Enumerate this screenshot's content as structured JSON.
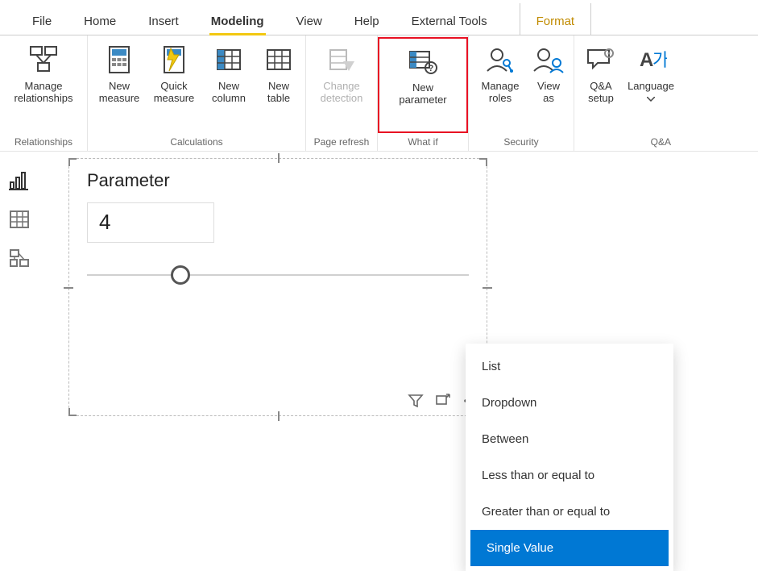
{
  "tabs": {
    "file": "File",
    "home": "Home",
    "insert": "Insert",
    "modeling": "Modeling",
    "view": "View",
    "help": "Help",
    "external": "External Tools",
    "format": "Format"
  },
  "ribbon": {
    "relationships": {
      "label": "Relationships",
      "manage": "Manage relationships"
    },
    "calculations": {
      "label": "Calculations",
      "new_measure": "New measure",
      "quick_measure": "Quick measure",
      "new_column": "New column",
      "new_table": "New table"
    },
    "page_refresh": {
      "label": "Page refresh",
      "change_detection": "Change detection"
    },
    "what_if": {
      "label": "What if",
      "new_parameter": "New parameter"
    },
    "security": {
      "label": "Security",
      "manage_roles": "Manage roles",
      "view_as": "View as"
    },
    "qa": {
      "label": "Q&A",
      "qa_setup": "Q&A setup",
      "language": "Language"
    }
  },
  "visual": {
    "title": "Parameter",
    "value": "4",
    "slider_percent": 22
  },
  "menu": {
    "items": [
      "List",
      "Dropdown",
      "Between",
      "Less than or equal to",
      "Greater than or equal to",
      "Single Value"
    ],
    "selected_index": 5
  }
}
